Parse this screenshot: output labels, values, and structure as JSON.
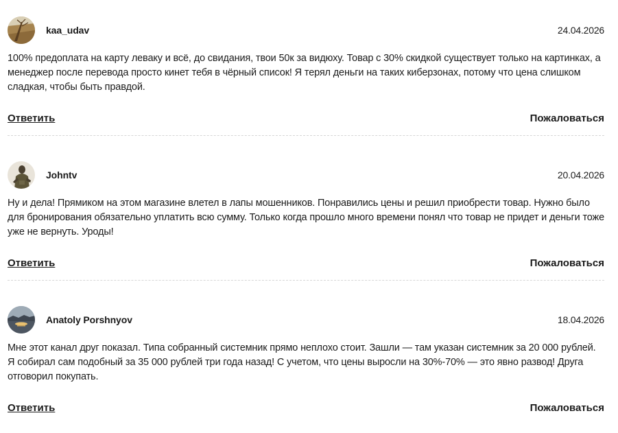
{
  "comments": [
    {
      "author": "kaa_udav",
      "date": "24.04.2026",
      "avatar_icon": "landscape-avatar-icon",
      "text": "100% предоплата на карту леваку и всё, до свидания, твои 50к за видюху. Товар с 30% скидкой существует только на картинках, а менеджер после перевода просто кинет тебя в чёрный список! Я терял деньги на таких киберзонах, потому что цена слишком сладкая, чтобы быть правдой.",
      "reply_label": "Ответить",
      "report_label": "Пожаловаться"
    },
    {
      "author": "Johntv",
      "date": "20.04.2026",
      "avatar_icon": "person-avatar-icon",
      "text": "Ну и дела! Прямиком на этом магазине влетел в лапы мошенников. Понравились цены и решил приобрести товар. Нужно было для бронирования обязательно уплатить всю сумму. Только когда прошло много времени понял что товар не придет и деньги тоже уже не вернуть. Уроды!",
      "reply_label": "Ответить",
      "report_label": "Пожаловаться"
    },
    {
      "author": "Anatoly Porshnyov",
      "date": "18.04.2026",
      "avatar_icon": "sunset-avatar-icon",
      "text": "Мне этот канал друг показал. Типа собранный системник прямо неплохо стоит. Зашли — там указан системник за 20 000 рублей. Я собирал сам подобный за 35 000 рублей три года назад! С учетом, что цены выросли на 30%-70% — это явно развод! Друга отговорил покупать.",
      "reply_label": "Ответить",
      "report_label": "Пожаловаться"
    }
  ],
  "colors": {
    "text": "#1a1a1a",
    "divider": "#d6d6d6"
  }
}
